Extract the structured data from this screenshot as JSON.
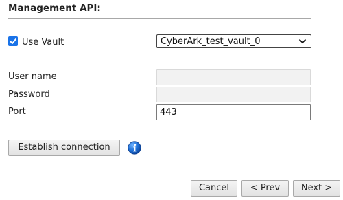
{
  "section": {
    "title": "Management API:"
  },
  "vault": {
    "checkbox_label": "Use Vault",
    "checked": true,
    "selected": "CyberArk_test_vault_0"
  },
  "fields": {
    "username_label": "User name",
    "username_value": "",
    "password_label": "Password",
    "password_value": "",
    "port_label": "Port",
    "port_value": "443"
  },
  "actions": {
    "establish_label": "Establish connection",
    "info_icon": "info-icon"
  },
  "footer": {
    "cancel_label": "Cancel",
    "prev_label": "< Prev",
    "next_label": "Next >"
  },
  "colors": {
    "checkbox_accent": "#1a73e8",
    "info_icon": "#1565c0"
  }
}
